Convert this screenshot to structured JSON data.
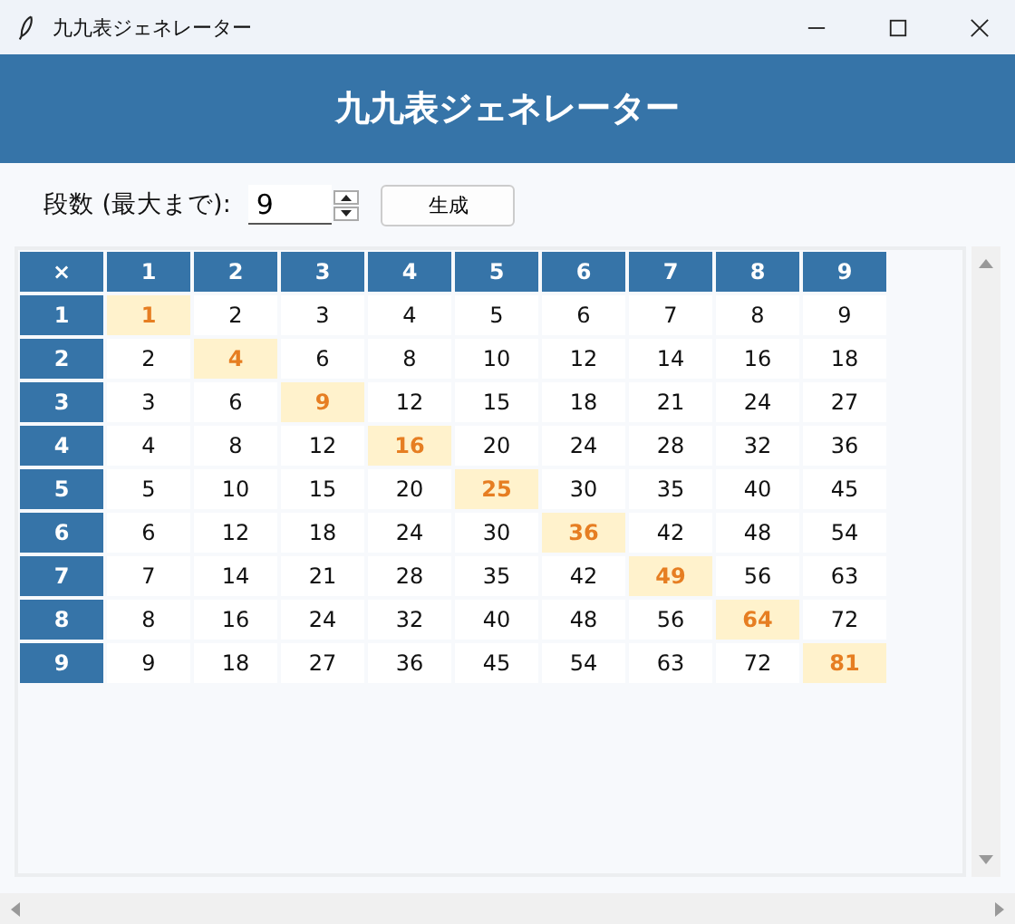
{
  "window": {
    "title": "九九表ジェネレーター"
  },
  "header": {
    "title": "九九表ジェネレーター"
  },
  "controls": {
    "label": "段数 (最大まで):",
    "spinbox_value": "9",
    "button": "生成"
  },
  "table": {
    "corner": "×",
    "columns": [
      "1",
      "2",
      "3",
      "4",
      "5",
      "6",
      "7",
      "8",
      "9"
    ],
    "rows": [
      {
        "header": "1",
        "cells": [
          {
            "text": "1",
            "highlighted": true
          },
          {
            "text": "2",
            "highlighted": false
          },
          {
            "text": "3",
            "highlighted": false
          },
          {
            "text": "4",
            "highlighted": false
          },
          {
            "text": "5",
            "highlighted": false
          },
          {
            "text": "6",
            "highlighted": false
          },
          {
            "text": "7",
            "highlighted": false
          },
          {
            "text": "8",
            "highlighted": false
          },
          {
            "text": "9",
            "highlighted": false
          }
        ]
      },
      {
        "header": "2",
        "cells": [
          {
            "text": "2",
            "highlighted": false
          },
          {
            "text": "4",
            "highlighted": true
          },
          {
            "text": "6",
            "highlighted": false
          },
          {
            "text": "8",
            "highlighted": false
          },
          {
            "text": "10",
            "highlighted": false
          },
          {
            "text": "12",
            "highlighted": false
          },
          {
            "text": "14",
            "highlighted": false
          },
          {
            "text": "16",
            "highlighted": false
          },
          {
            "text": "18",
            "highlighted": false
          }
        ]
      },
      {
        "header": "3",
        "cells": [
          {
            "text": "3",
            "highlighted": false
          },
          {
            "text": "6",
            "highlighted": false
          },
          {
            "text": "9",
            "highlighted": true
          },
          {
            "text": "12",
            "highlighted": false
          },
          {
            "text": "15",
            "highlighted": false
          },
          {
            "text": "18",
            "highlighted": false
          },
          {
            "text": "21",
            "highlighted": false
          },
          {
            "text": "24",
            "highlighted": false
          },
          {
            "text": "27",
            "highlighted": false
          }
        ]
      },
      {
        "header": "4",
        "cells": [
          {
            "text": "4",
            "highlighted": false
          },
          {
            "text": "8",
            "highlighted": false
          },
          {
            "text": "12",
            "highlighted": false
          },
          {
            "text": "16",
            "highlighted": true
          },
          {
            "text": "20",
            "highlighted": false
          },
          {
            "text": "24",
            "highlighted": false
          },
          {
            "text": "28",
            "highlighted": false
          },
          {
            "text": "32",
            "highlighted": false
          },
          {
            "text": "36",
            "highlighted": false
          }
        ]
      },
      {
        "header": "5",
        "cells": [
          {
            "text": "5",
            "highlighted": false
          },
          {
            "text": "10",
            "highlighted": false
          },
          {
            "text": "15",
            "highlighted": false
          },
          {
            "text": "20",
            "highlighted": false
          },
          {
            "text": "25",
            "highlighted": true
          },
          {
            "text": "30",
            "highlighted": false
          },
          {
            "text": "35",
            "highlighted": false
          },
          {
            "text": "40",
            "highlighted": false
          },
          {
            "text": "45",
            "highlighted": false
          }
        ]
      },
      {
        "header": "6",
        "cells": [
          {
            "text": "6",
            "highlighted": false
          },
          {
            "text": "12",
            "highlighted": false
          },
          {
            "text": "18",
            "highlighted": false
          },
          {
            "text": "24",
            "highlighted": false
          },
          {
            "text": "30",
            "highlighted": false
          },
          {
            "text": "36",
            "highlighted": true
          },
          {
            "text": "42",
            "highlighted": false
          },
          {
            "text": "48",
            "highlighted": false
          },
          {
            "text": "54",
            "highlighted": false
          }
        ]
      },
      {
        "header": "7",
        "cells": [
          {
            "text": "7",
            "highlighted": false
          },
          {
            "text": "14",
            "highlighted": false
          },
          {
            "text": "21",
            "highlighted": false
          },
          {
            "text": "28",
            "highlighted": false
          },
          {
            "text": "35",
            "highlighted": false
          },
          {
            "text": "42",
            "highlighted": false
          },
          {
            "text": "49",
            "highlighted": true
          },
          {
            "text": "56",
            "highlighted": false
          },
          {
            "text": "63",
            "highlighted": false
          }
        ]
      },
      {
        "header": "8",
        "cells": [
          {
            "text": "8",
            "highlighted": false
          },
          {
            "text": "16",
            "highlighted": false
          },
          {
            "text": "24",
            "highlighted": false
          },
          {
            "text": "32",
            "highlighted": false
          },
          {
            "text": "40",
            "highlighted": false
          },
          {
            "text": "48",
            "highlighted": false
          },
          {
            "text": "56",
            "highlighted": false
          },
          {
            "text": "64",
            "highlighted": true
          },
          {
            "text": "72",
            "highlighted": false
          }
        ]
      },
      {
        "header": "9",
        "cells": [
          {
            "text": "9",
            "highlighted": false
          },
          {
            "text": "18",
            "highlighted": false
          },
          {
            "text": "27",
            "highlighted": false
          },
          {
            "text": "36",
            "highlighted": false
          },
          {
            "text": "45",
            "highlighted": false
          },
          {
            "text": "54",
            "highlighted": false
          },
          {
            "text": "63",
            "highlighted": false
          },
          {
            "text": "72",
            "highlighted": false
          },
          {
            "text": "81",
            "highlighted": true
          }
        ]
      }
    ]
  }
}
